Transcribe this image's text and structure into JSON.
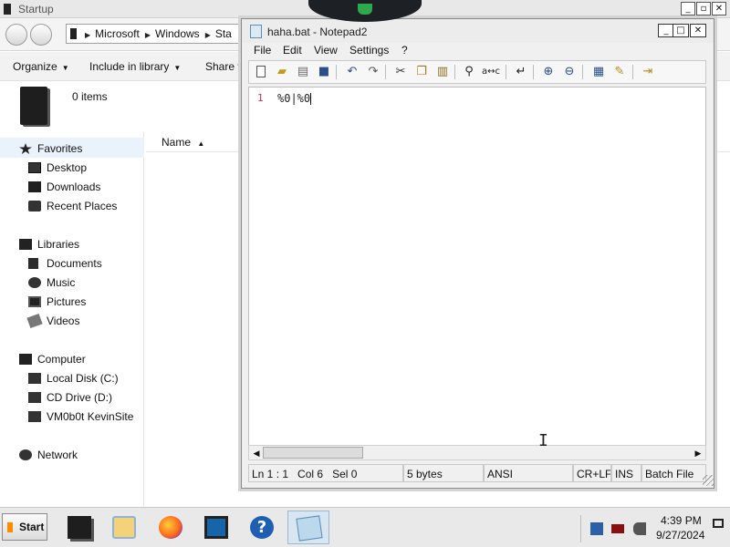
{
  "explorer": {
    "title": "Startup",
    "window_controls": [
      "_",
      "▫",
      "✕"
    ],
    "breadcrumb": [
      "Microsoft",
      "Windows",
      "Sta"
    ],
    "commands": {
      "organize": "Organize",
      "include_library": "Include in library",
      "share": "Share v"
    },
    "items_count": "0 items",
    "column_name": "Name",
    "nav": {
      "favorites": "Favorites",
      "desktop": "Desktop",
      "downloads": "Downloads",
      "recent_places": "Recent Places",
      "libraries": "Libraries",
      "documents": "Documents",
      "music": "Music",
      "pictures": "Pictures",
      "videos": "Videos",
      "computer": "Computer",
      "local_disk": "Local Disk (C:)",
      "cd_drive": "CD Drive (D:)",
      "vm_site": "VM0b0t KevinSite",
      "network": "Network"
    }
  },
  "notepad": {
    "title": "haha.bat - Notepad2",
    "window_controls": [
      "_",
      "□",
      "✕"
    ],
    "menu": {
      "file": "File",
      "edit": "Edit",
      "view": "View",
      "settings": "Settings",
      "help": "?"
    },
    "editor": {
      "line_number": "1",
      "code_text": "%0|%0"
    },
    "status": {
      "position": "Ln 1 : 1",
      "column": "Col 6",
      "selection": "Sel 0",
      "size": "5 bytes",
      "encoding": "ANSI",
      "line_ending": "CR+LF",
      "insert_mode": "INS",
      "scheme": "Batch File"
    },
    "toolbar_icons": [
      "new-icon",
      "open-icon",
      "browse-icon",
      "save-icon",
      "undo-icon",
      "redo-icon",
      "cut-icon",
      "copy-icon",
      "paste-icon",
      "find-icon",
      "replace-icon",
      "wordwrap-icon",
      "zoom-in-icon",
      "zoom-out-icon",
      "scheme-icon",
      "customize-scheme-icon",
      "exit-icon"
    ]
  },
  "taskbar": {
    "start_label": "Start",
    "clock_time": "4:39 PM",
    "clock_date": "9/27/2024"
  },
  "colors": {
    "line_number": "#d03030",
    "start_accent": "#ff8a00",
    "notch_indicator": "#2ea84d",
    "selected_nav_bg": "#eaf2fb"
  }
}
